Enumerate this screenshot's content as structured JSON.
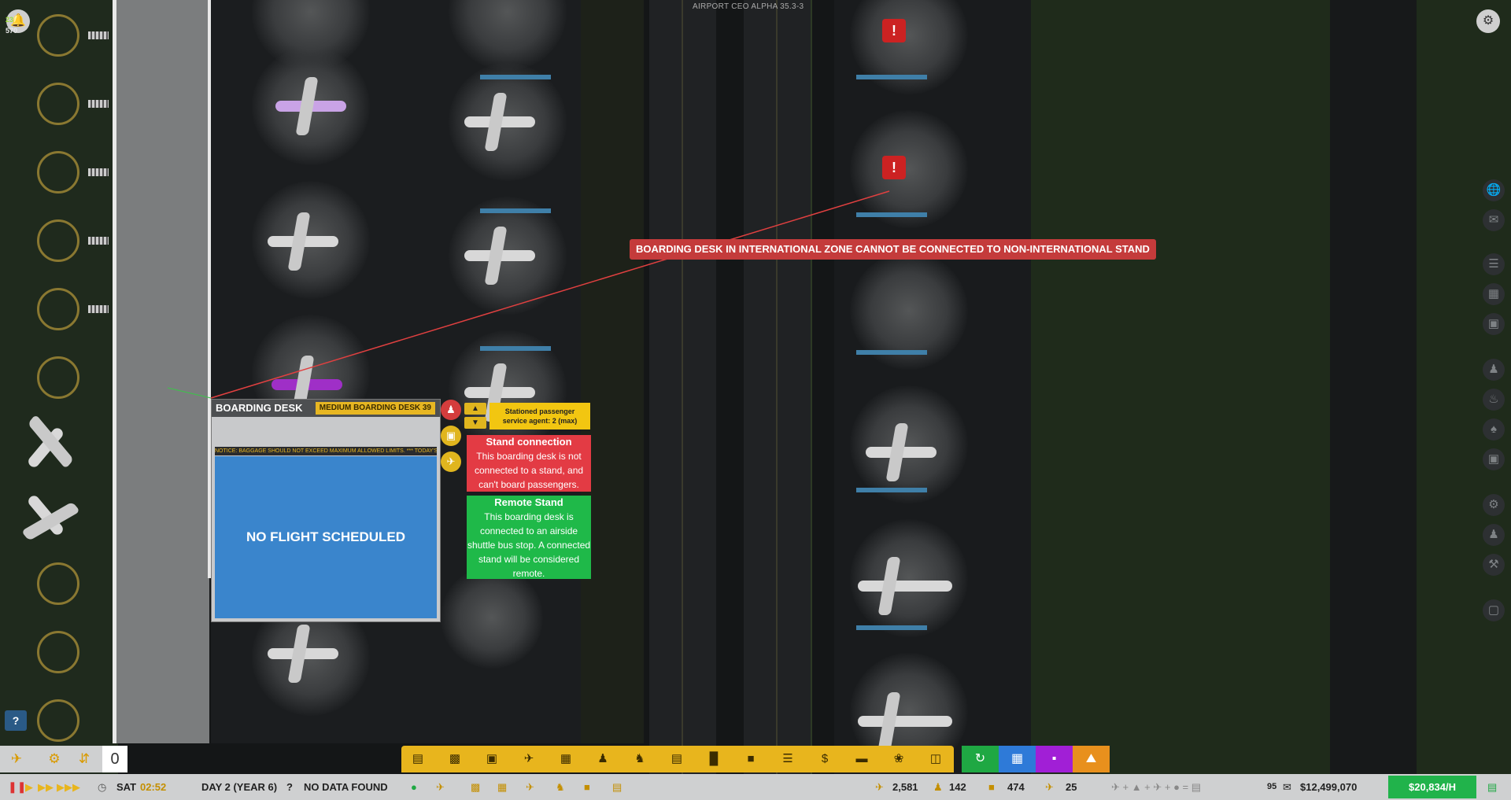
{
  "top_title": "AIRPORT CEO ALPHA 35.3-3",
  "notification": {
    "count_top": "23",
    "count_bottom": "570"
  },
  "error_banner": "BOARDING DESK IN INTERNATIONAL ZONE CANNOT BE CONNECTED TO NON-INTERNATIONAL STAND",
  "desk_panel": {
    "title": "BOARDING DESK",
    "badge": "MEDIUM BOARDING DESK 39",
    "ticker": "NOTICE: BAGGAGE SHOULD NOT EXCEED MAXIMUM ALLOWED LIMITS. *** TODAY'S WEATH",
    "status": "NO FLIGHT SCHEDULED"
  },
  "agent_info": {
    "line1": "Stationed passenger",
    "line2": "service agent: 2 (max)"
  },
  "stand_connection": {
    "title": "Stand connection",
    "text": "This boarding desk is not connected to a stand, and can't board passengers."
  },
  "remote_stand": {
    "title": "Remote Stand",
    "text": "This boarding desk is connected to an airside shuttle bus stop. A connected stand will be considered remote."
  },
  "bottom_bar": {
    "day": "SAT",
    "time": "02:52",
    "day_label": "DAY 2 (YEAR 6)",
    "data_status": "NO DATA FOUND",
    "stat_flights": "2,581",
    "stat_staff": "142",
    "stat_bags": "474",
    "stat_planes": "25",
    "mail_count": "95",
    "money": "$12,499,070",
    "income": "$20,834/H",
    "speed_value": "0"
  },
  "help_label": "?",
  "icons": {
    "settings": "gear-icon",
    "globe": "globe-icon",
    "mail": "mail-icon",
    "bell": "bell-icon"
  },
  "colors": {
    "error": "#c43b3b",
    "toolbar": "#e8b51d",
    "desk_screen": "#3a85cc",
    "stand_connection": "#e33b44",
    "remote_stand": "#1fb949",
    "income": "#21b34b"
  }
}
